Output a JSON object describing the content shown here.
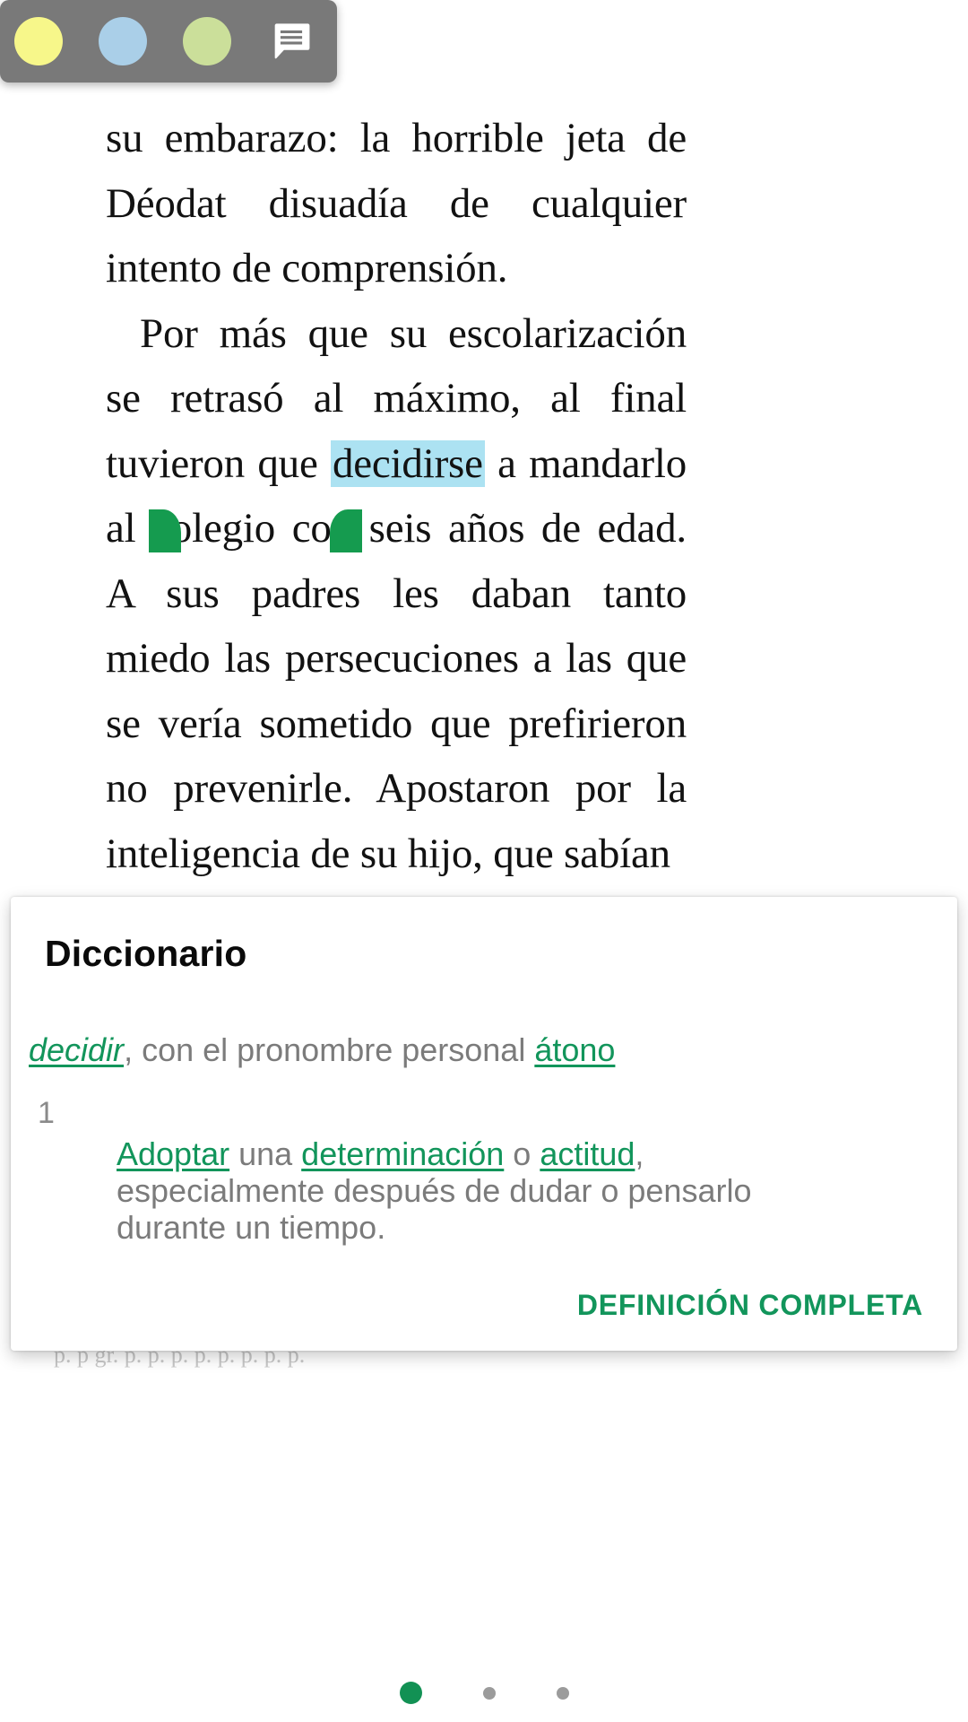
{
  "app": {
    "screen_type": "ebook-reader-with-dictionary-popup"
  },
  "highlight_toolbar": {
    "swatches": [
      {
        "name": "yellow-highlight",
        "color": "#f7f78a"
      },
      {
        "name": "blue-highlight",
        "color": "#aacfe8"
      },
      {
        "name": "green-highlight",
        "color": "#cbdf9a"
      }
    ],
    "note_icon": "note-comment-icon",
    "background": "#797979"
  },
  "book": {
    "paragraphs": [
      {
        "indented": false,
        "runs": [
          {
            "text": "su embarazo: la horrible jeta de Déodat disuadía de cualquier intento de comprensión.",
            "selected": false
          }
        ]
      },
      {
        "indented": true,
        "runs": [
          {
            "text": "Por más que su escolarización se retrasó al máximo, al final tuvieron que ",
            "selected": false
          },
          {
            "text": "decidirse",
            "selected": true
          },
          {
            "text": " a mandarlo al colegio con seis años de edad. A sus padres les daban tanto miedo las persecuciones a las que se vería sometido que prefirieron no prevenirle. Apostaron por la inteligencia de su hijo, que sabían",
            "selected": false
          }
        ]
      }
    ],
    "selected_word": "decidirse",
    "selection_color": "#ace2f2",
    "handle_color": "#159b4f",
    "footer_faint_text": "p. p gr. p. p. p.  p. p. p. p. p."
  },
  "dictionary": {
    "title": "Diccionario",
    "headword": "decidir",
    "headword_suffix": ", con el pronombre personal ",
    "headword_link2": "átono",
    "senses": [
      {
        "number": "1",
        "segments": [
          {
            "text": "Adoptar",
            "link": true
          },
          {
            "text": " una ",
            "link": false
          },
          {
            "text": "determinación",
            "link": true
          },
          {
            "text": " o ",
            "link": false
          },
          {
            "text": "actitud",
            "link": true
          },
          {
            "text": ", especialmente después de dudar o pensarlo durante un tiempo.",
            "link": false
          }
        ]
      }
    ],
    "full_definition_label": "DEFINICIÓN COMPLETA",
    "accent_color": "#12955b",
    "body_text_color": "#7b7b7b"
  },
  "page_indicator": {
    "total": 3,
    "active_index": 0,
    "active_color": "#129154",
    "inactive_color": "#9b9b9b"
  }
}
